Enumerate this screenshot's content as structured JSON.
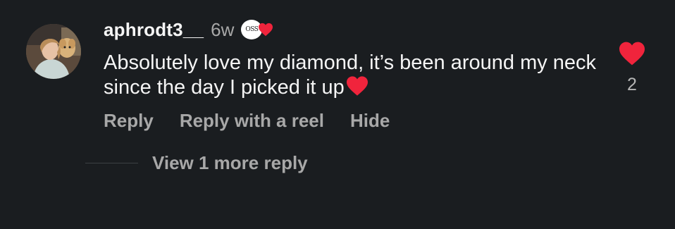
{
  "comment": {
    "username": "aphrodt3__",
    "time": "6w",
    "badge_text": "OSS",
    "text": "Absolutely love my diamond, it’s been around my neck since the day I picked it up",
    "like_count": "2"
  },
  "actions": {
    "reply": "Reply",
    "reply_reel": "Reply with a reel",
    "hide": "Hide"
  },
  "view_more": "View 1 more reply",
  "icons": {
    "avatar": "avatar-photo",
    "badge": "oss-badge-icon",
    "heart": "heart-icon",
    "like": "heart-icon"
  },
  "colors": {
    "background": "#1a1d20",
    "heart": "#f0243c",
    "text": "#f5f5f5",
    "muted": "#a8a8a8"
  }
}
